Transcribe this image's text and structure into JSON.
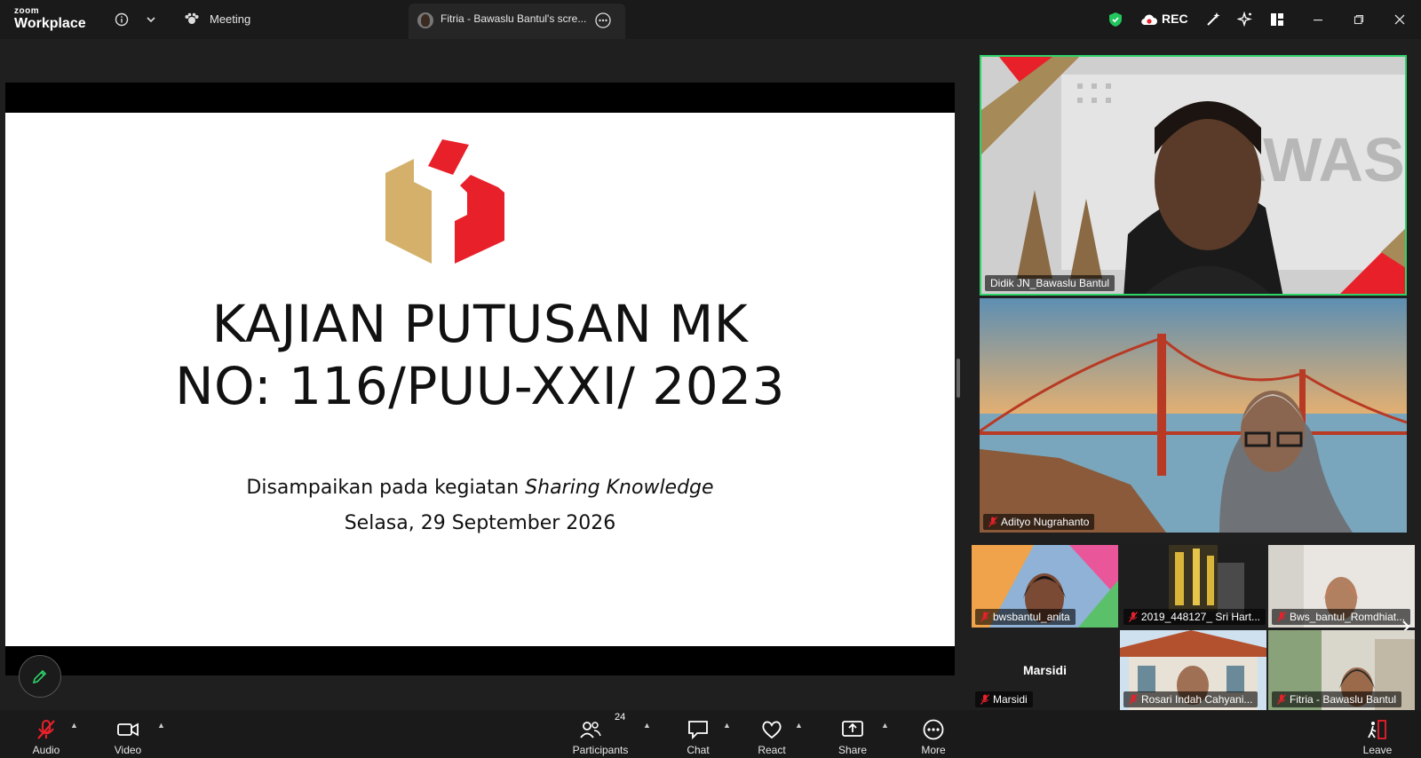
{
  "titlebar": {
    "brand_top": "zoom",
    "brand_bottom": "Workplace",
    "meeting_label": "Meeting",
    "share_tab_label": "Fitria - Bawaslu Bantul's scre...",
    "rec_label": "REC"
  },
  "slide": {
    "title_line1": "KAJIAN PUTUSAN MK",
    "title_line2": "NO: 116/PUU-XXI/ 2023",
    "sub_prefix": "Disampaikan pada kegiatan ",
    "sub_italic": "Sharing Knowledge",
    "date_line": "Selasa, 29 September 2026",
    "logo_colors": {
      "gold": "#d4b06a",
      "red": "#e8202a"
    }
  },
  "participants": {
    "main": {
      "name": "Didik JN_Bawaslu Bantul"
    },
    "second": {
      "name": "Adityo Nugrahanto"
    },
    "grid": [
      {
        "name": "bwsbantul_anita"
      },
      {
        "name": "2019_448127_ Sri Hart..."
      },
      {
        "name": "Bws_bantul_Romdhiat..."
      },
      {
        "name": "Marsidi",
        "placeholder": "Marsidi"
      },
      {
        "name": "Rosari Indah Cahyani..."
      },
      {
        "name": "Fitria - Bawaslu Bantul"
      }
    ]
  },
  "toolbar": {
    "audio": "Audio",
    "video": "Video",
    "participants": "Participants",
    "participants_count": "24",
    "chat": "Chat",
    "react": "React",
    "share": "Share",
    "more": "More",
    "leave": "Leave"
  },
  "colors": {
    "active_speaker": "#2ed36a",
    "accent_red": "#e8202a"
  }
}
